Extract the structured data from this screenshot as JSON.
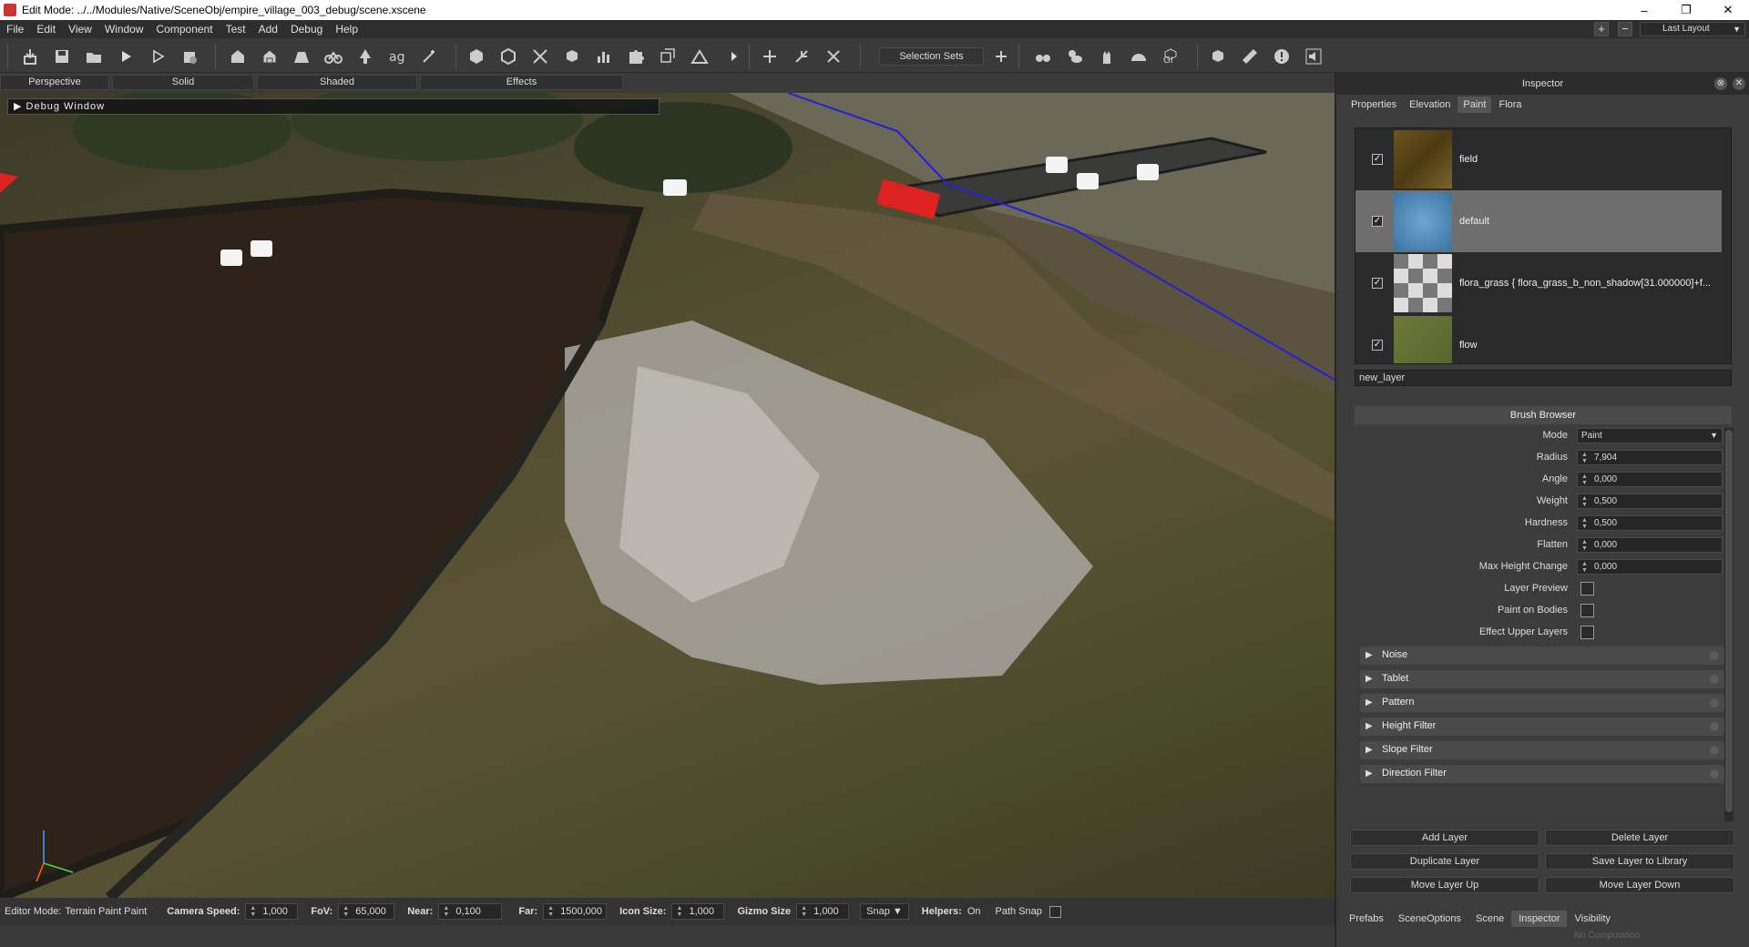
{
  "window": {
    "title": "Edit Mode: ../../Modules/Native/SceneObj/empire_village_003_debug/scene.xscene",
    "controls": [
      "–",
      "❐",
      "✕"
    ]
  },
  "menu": [
    "File",
    "Edit",
    "View",
    "Window",
    "Component",
    "Test",
    "Add",
    "Debug",
    "Help"
  ],
  "layout_select": "Last Layout",
  "toolbar": {
    "selection_sets": "Selection Sets"
  },
  "view_tabs": [
    "Perspective",
    "Solid",
    "Shaded",
    "Effects"
  ],
  "viewport": {
    "debug_window": "Debug Window"
  },
  "status": {
    "editor_mode_label": "Editor Mode:",
    "editor_mode_value": "Terrain Paint Paint",
    "camera_speed_label": "Camera Speed:",
    "camera_speed": "1,000",
    "fov_label": "FoV:",
    "fov": "65,000",
    "near_label": "Near:",
    "near": "0,100",
    "far_label": "Far:",
    "far": "1500,000",
    "icon_size_label": "Icon Size:",
    "icon_size": "1,000",
    "gizmo_size_label": "Gizmo Size",
    "gizmo_size": "1,000",
    "snap": "Snap ▼",
    "helpers_label": "Helpers:",
    "helpers_value": "On",
    "path_snap": "Path Snap"
  },
  "inspector": {
    "title": "Inspector",
    "tabs": [
      "Properties",
      "Elevation",
      "Paint",
      "Flora"
    ],
    "active_tab": "Paint",
    "layers": [
      {
        "name": "field",
        "checked": true,
        "selected": false
      },
      {
        "name": "default",
        "checked": true,
        "selected": true
      },
      {
        "name": "flora_grass { flora_grass_b_non_shadow[31.000000]+f...",
        "checked": true,
        "selected": false
      },
      {
        "name": "flow",
        "checked": true,
        "selected": false
      }
    ],
    "new_layer_name": "new_layer",
    "brush_browser": {
      "title": "Brush Browser",
      "mode_label": "Mode",
      "mode_value": "Paint",
      "params": [
        {
          "label": "Radius",
          "value": "7,904"
        },
        {
          "label": "Angle",
          "value": "0,000"
        },
        {
          "label": "Weight",
          "value": "0,500"
        },
        {
          "label": "Hardness",
          "value": "0,500"
        },
        {
          "label": "Flatten",
          "value": "0,000"
        },
        {
          "label": "Max Height Change",
          "value": "0,000"
        }
      ],
      "checks": [
        {
          "label": "Layer Preview",
          "checked": false
        },
        {
          "label": "Paint on Bodies",
          "checked": false
        },
        {
          "label": "Effect Upper Layers",
          "checked": false
        }
      ],
      "sections": [
        "Noise",
        "Tablet",
        "Pattern",
        "Height Filter",
        "Slope Filter",
        "Direction Filter"
      ]
    },
    "actions": [
      "Add Layer",
      "Delete Layer",
      "Duplicate Layer",
      "Save Layer to Library",
      "Move Layer Up",
      "Move Layer Down"
    ]
  },
  "bottom_tabs": [
    "Prefabs",
    "SceneOptions",
    "Scene",
    "Inspector",
    "Visibility"
  ],
  "bottom_active": "Inspector",
  "no_computation": "No Computation"
}
